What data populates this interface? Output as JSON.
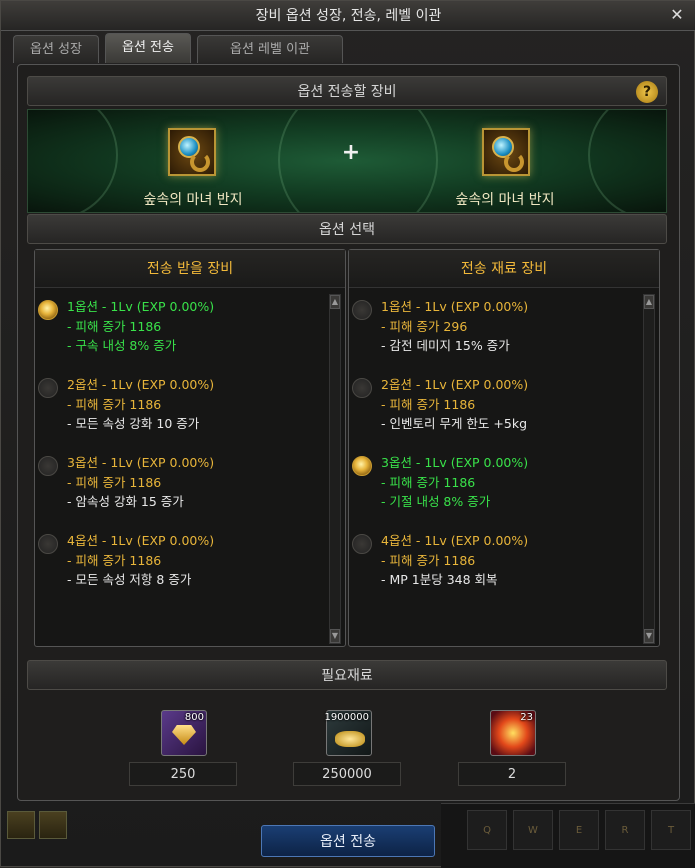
{
  "window": {
    "title": "장비 옵션 성장, 전송, 레벨 이관",
    "close_icon": "close-icon"
  },
  "tabs": [
    {
      "label": "옵션 성장",
      "active": false
    },
    {
      "label": "옵션 전송",
      "active": true
    },
    {
      "label": "옵션 레벨 이관",
      "active": false
    }
  ],
  "equip_section": {
    "title": "옵션 전송할 장비",
    "help": "?"
  },
  "items": {
    "left_name": "숲속의 마녀 반지",
    "right_name": "숲속의 마녀 반지",
    "plus": "+"
  },
  "option_section": {
    "title": "옵션 선택"
  },
  "receive": {
    "title": "전송 받을 장비",
    "options": [
      {
        "l1": "1옵션 - 1Lv (EXP 0.00%)",
        "l2": "- 피해 증가 1186",
        "l3": "- 구속 내성 8% 증가",
        "selected": true
      },
      {
        "l1": "2옵션 - 1Lv (EXP 0.00%)",
        "l2": "- 피해 증가 1186",
        "l3": "- 모든 속성 강화 10 증가",
        "selected": false
      },
      {
        "l1": "3옵션 - 1Lv (EXP 0.00%)",
        "l2": "- 피해 증가 1186",
        "l3": "- 암속성 강화 15 증가",
        "selected": false
      },
      {
        "l1": "4옵션 - 1Lv (EXP 0.00%)",
        "l2": "- 피해 증가 1186",
        "l3": "- 모든 속성 저항 8 증가",
        "selected": false
      }
    ]
  },
  "material": {
    "title": "전송 재료 장비",
    "options": [
      {
        "l1": "1옵션 - 1Lv (EXP 0.00%)",
        "l2": "- 피해 증가 296",
        "l3": "- 감전 데미지 15% 증가",
        "selected": false
      },
      {
        "l1": "2옵션 - 1Lv (EXP 0.00%)",
        "l2": "- 피해 증가 1186",
        "l3": "- 인벤토리 무게 한도 +5kg",
        "selected": false
      },
      {
        "l1": "3옵션 - 1Lv (EXP 0.00%)",
        "l2": "- 피해 증가 1186",
        "l3": "- 기절 내성 8% 증가",
        "selected": true
      },
      {
        "l1": "4옵션 - 1Lv (EXP 0.00%)",
        "l2": "- 피해 증가 1186",
        "l3": "- MP 1분당 348 회복",
        "selected": false
      }
    ]
  },
  "required": {
    "title": "필요재료",
    "mats": [
      {
        "icon": "gold-crystal-icon",
        "stack": "800",
        "value": "250"
      },
      {
        "icon": "gold-coins-icon",
        "stack": "1900000",
        "value": "250000"
      },
      {
        "icon": "explosion-orb-icon",
        "stack": "23",
        "value": "2"
      }
    ]
  },
  "actions": {
    "transfer": "옵션 전송"
  },
  "hotkeys": [
    "Q",
    "W",
    "E",
    "R",
    "T"
  ],
  "colors": {
    "gold": "#e8b53a",
    "green": "#39e24a",
    "accent_blue": "#1a3e73"
  }
}
